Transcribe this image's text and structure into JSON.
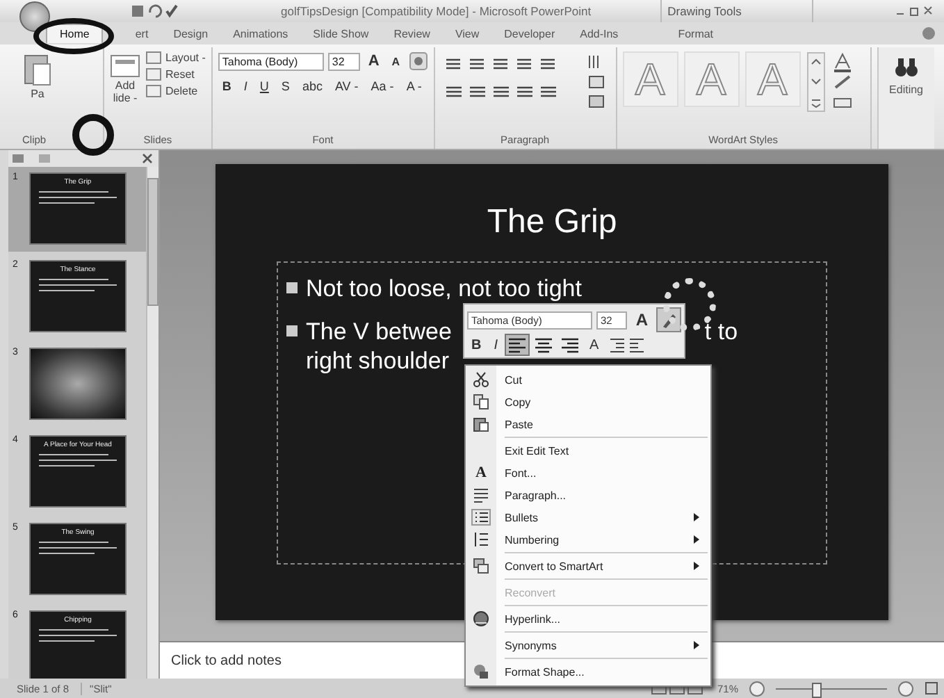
{
  "title_bar": {
    "title": "golfTipsDesign [Compatibility Mode] - Microsoft PowerPoint",
    "contextual": "Drawing Tools"
  },
  "tabs": [
    {
      "label": "Home",
      "selected": true
    },
    {
      "label": "ert",
      "selected": false
    },
    {
      "label": "Design",
      "selected": false
    },
    {
      "label": "Animations",
      "selected": false
    },
    {
      "label": "Slide Show",
      "selected": false
    },
    {
      "label": "Review",
      "selected": false
    },
    {
      "label": "View",
      "selected": false
    },
    {
      "label": "Developer",
      "selected": false
    },
    {
      "label": "Add-Ins",
      "selected": false
    },
    {
      "label": "Format",
      "selected": false
    }
  ],
  "clipboard": {
    "label": "Clipb",
    "paste": "Pa"
  },
  "slides_group": {
    "label": "Slides",
    "new_slide": [
      "Add",
      "lide -"
    ],
    "commands": [
      "Layout -",
      "Reset",
      "Delete"
    ]
  },
  "font_group": {
    "label": "Font",
    "font": "Tahoma (Body)",
    "size": "32",
    "grow": "A",
    "shrink": "A",
    "buttons": [
      "B",
      "I",
      "U",
      "S",
      "abc",
      "AV -",
      "Aa -",
      "A -"
    ]
  },
  "paragraph_group": {
    "label": "Paragraph"
  },
  "wordart_group": {
    "label": "WordArt Styles",
    "styles": [
      "A",
      "A",
      "A"
    ]
  },
  "editing_group": {
    "label": "Editing"
  },
  "slide_pane": {
    "thumbnails": [
      {
        "number": "1",
        "kind": "text",
        "title": "The Grip",
        "selected": true
      },
      {
        "number": "2",
        "kind": "text",
        "title": "The Stance",
        "selected": false
      },
      {
        "number": "3",
        "kind": "photo",
        "selected": false
      },
      {
        "number": "4",
        "kind": "text",
        "title": "A Place for Your Head",
        "selected": false
      },
      {
        "number": "5",
        "kind": "text",
        "title": "The Swing",
        "selected": false
      },
      {
        "number": "6",
        "kind": "text",
        "title": "Chipping",
        "selected": false
      }
    ]
  },
  "slide": {
    "title": "The Grip",
    "bullets": [
      {
        "segments": [
          "Not too loose, not too tight"
        ]
      },
      {
        "segments": [
          "The V betwee",
          "t to"
        ],
        "continuation": "right shoulder"
      }
    ]
  },
  "mini_toolbar": {
    "font": "Tahoma (Body)",
    "size": "32",
    "grow": "A",
    "buttons": [
      {
        "kind": "text",
        "label": "B",
        "selected": false
      },
      {
        "kind": "text",
        "label": "I",
        "selected": false
      },
      {
        "kind": "align-left",
        "selected": true
      },
      {
        "kind": "align-center",
        "selected": false
      },
      {
        "kind": "align-right",
        "selected": false
      },
      {
        "kind": "text",
        "label": "A",
        "selected": false
      },
      {
        "kind": "indent",
        "selected": false
      }
    ]
  },
  "context_menu": [
    {
      "kind": "item",
      "label": "Cut",
      "submenu": false,
      "disabled": false
    },
    {
      "kind": "item",
      "label": "Copy",
      "submenu": false,
      "disabled": false
    },
    {
      "kind": "item",
      "label": "Paste",
      "submenu": false,
      "disabled": false
    },
    {
      "kind": "separator"
    },
    {
      "kind": "item",
      "label": "Exit Edit Text",
      "submenu": false,
      "disabled": false
    },
    {
      "kind": "item",
      "label": "Font...",
      "glyph": "A",
      "submenu": false,
      "disabled": false
    },
    {
      "kind": "item",
      "label": "Paragraph...",
      "submenu": false,
      "disabled": false
    },
    {
      "kind": "item",
      "label": "Bullets",
      "submenu": true,
      "disabled": false
    },
    {
      "kind": "item",
      "label": "Numbering",
      "submenu": true,
      "disabled": false
    },
    {
      "kind": "separator"
    },
    {
      "kind": "item",
      "label": "Convert to SmartArt",
      "submenu": true,
      "disabled": false
    },
    {
      "kind": "separator"
    },
    {
      "kind": "item",
      "label": "Reconvert",
      "submenu": false,
      "disabled": true
    },
    {
      "kind": "separator"
    },
    {
      "kind": "item",
      "label": "Hyperlink...",
      "submenu": false,
      "disabled": false
    },
    {
      "kind": "separator"
    },
    {
      "kind": "item",
      "label": "Synonyms",
      "submenu": true,
      "disabled": false
    },
    {
      "kind": "separator"
    },
    {
      "kind": "item",
      "label": "Format Shape...",
      "submenu": false,
      "disabled": false
    }
  ],
  "notes": {
    "placeholder": "Click to add notes"
  },
  "status_bar": {
    "slide": "Slide 1 of 8",
    "theme": "\"Slit\"",
    "zoom": "71%",
    "zoom_slider": {
      "level": 0.36
    }
  }
}
